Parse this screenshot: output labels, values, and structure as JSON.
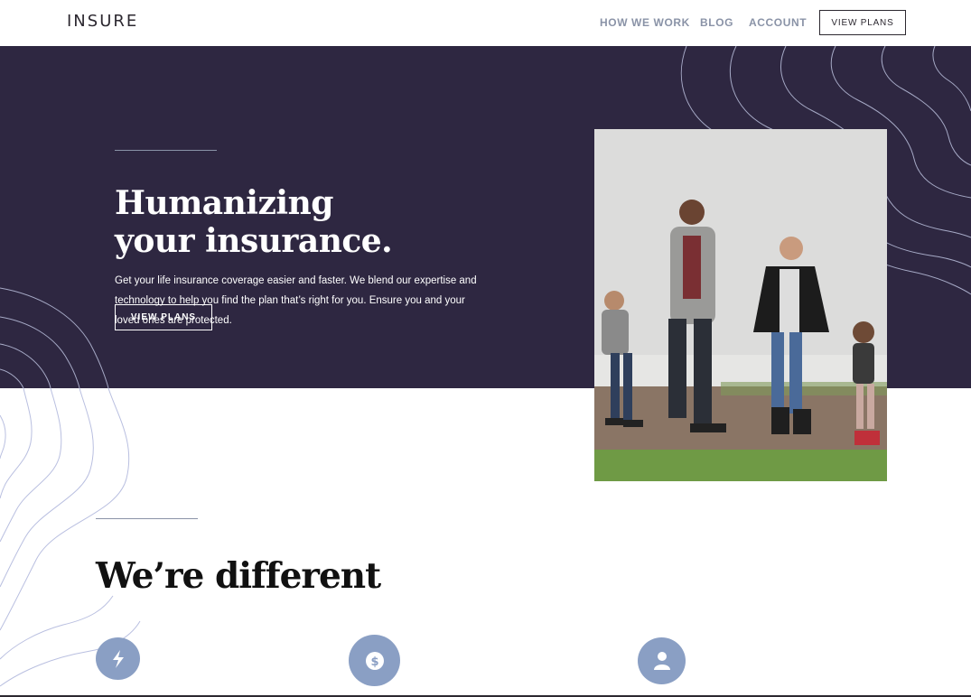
{
  "header": {
    "logo": "INSURE",
    "nav": [
      {
        "label": "HOW WE WORK"
      },
      {
        "label": "BLOG"
      },
      {
        "label": "ACCOUNT"
      }
    ],
    "cta_label": "VIEW PLANS"
  },
  "hero": {
    "title_line1": "Humanizing",
    "title_line2": "your insurance.",
    "description": "Get your life insurance coverage easier and faster. We blend our expertise and technology to help you find the plan that’s right for you. Ensure you and your loved ones are protected.",
    "button_label": "VIEW PLANS"
  },
  "different": {
    "title": "We’re different",
    "features": [
      {
        "icon": "lightning-icon"
      },
      {
        "icon": "dollar-icon"
      },
      {
        "icon": "person-icon"
      }
    ]
  },
  "colors": {
    "hero_bg": "#2e2741",
    "accent": "#8a9fc4",
    "text_dark": "#2c2830",
    "nav_text": "#8a93a7"
  }
}
